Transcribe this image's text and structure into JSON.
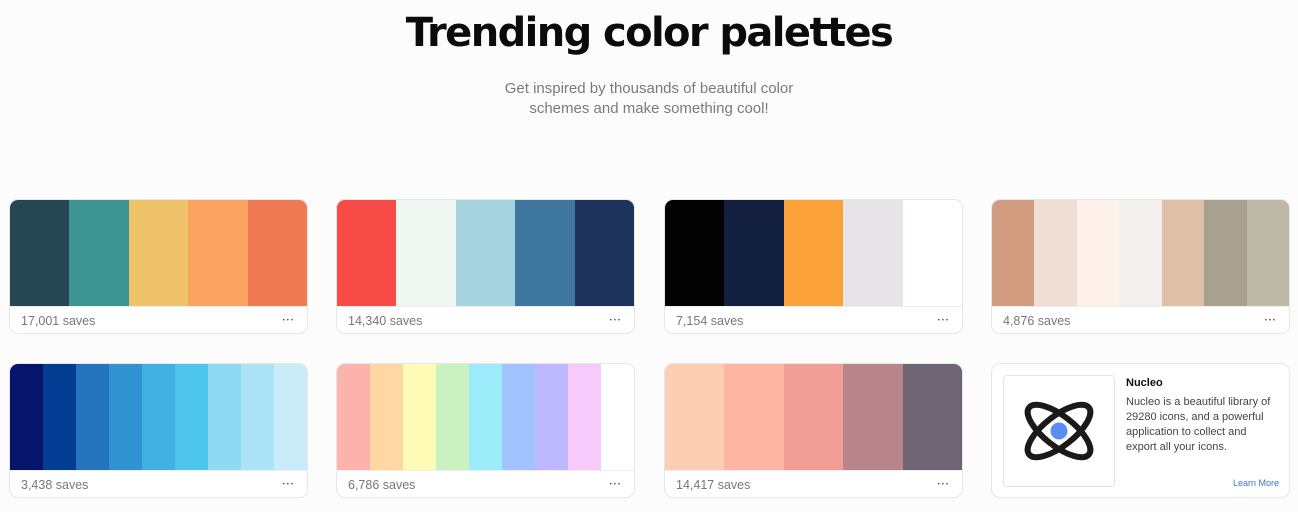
{
  "header": {
    "title": "Trending color palettes",
    "subtitle": "Get inspired by thousands of beautiful color schemes and make something cool!"
  },
  "palettes": [
    {
      "saves": "17,001 saves",
      "colors": [
        "#264653",
        "#3d9691",
        "#f0c36a",
        "#fca562",
        "#f07a52"
      ]
    },
    {
      "saves": "14,340 saves",
      "colors": [
        "#f74b47",
        "#f0f7f0",
        "#a7d3df",
        "#3e76a0",
        "#1d335a"
      ]
    },
    {
      "saves": "7,154 saves",
      "colors": [
        "#020203",
        "#131f3e",
        "#fba23a",
        "#e6e4e6",
        "#ffffff"
      ]
    },
    {
      "saves": "4,876 saves",
      "colors": [
        "#d19c80",
        "#f0ddd4",
        "#fef2ea",
        "#f3efee",
        "#e1c0aa",
        "#a8a18f",
        "#bfb9a7"
      ]
    },
    {
      "saves": "3,438 saves",
      "colors": [
        "#06156a",
        "#033c93",
        "#2474bd",
        "#3194d2",
        "#41b1e2",
        "#4cc4ec",
        "#8fd9f3",
        "#ade3f6",
        "#caecf9"
      ]
    },
    {
      "saves": "6,786 saves",
      "colors": [
        "#fcb3ac",
        "#fed7a4",
        "#fefbb6",
        "#cbf1c1",
        "#9cecfc",
        "#a2c3fe",
        "#beb8fe",
        "#f6cbfc",
        "#ffffff"
      ]
    },
    {
      "saves": "14,417 saves",
      "colors": [
        "#fdceb4",
        "#fcb6a2",
        "#f19e97",
        "#b8858a",
        "#6e6474"
      ]
    }
  ],
  "ad": {
    "name": "Nucleo",
    "description": "Nucleo is a beautiful library of 29280 icons, and a powerful application to collect and export all your icons.",
    "link": "Learn More",
    "icon": "nucleo-atom-icon",
    "accent_color": "#5b8df5"
  },
  "icons": {
    "more": "more-horizontal-icon"
  }
}
